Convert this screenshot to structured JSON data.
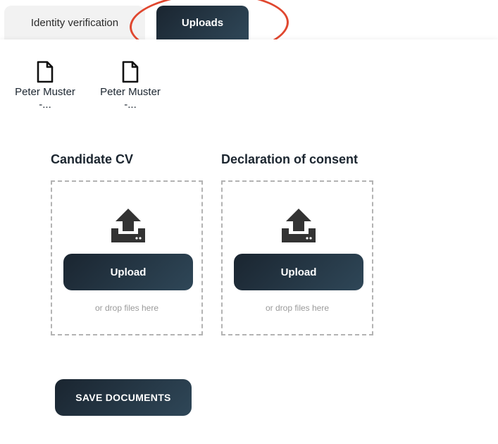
{
  "tabs": [
    {
      "label": "Identity verification",
      "active": false
    },
    {
      "label": "Uploads",
      "active": true
    }
  ],
  "files": [
    {
      "name": "Peter Muster",
      "ellipsis": "-...",
      "icon": "document-icon"
    },
    {
      "name": "Peter Muster",
      "ellipsis": "-...",
      "icon": "document-icon"
    }
  ],
  "uploads": [
    {
      "title": "Candidate CV",
      "button_label": "Upload",
      "hint": "or drop files here",
      "icon": "upload-icon"
    },
    {
      "title": "Declaration of consent",
      "button_label": "Upload",
      "hint": "or drop files here",
      "icon": "upload-icon"
    }
  ],
  "save_label": "SAVE DOCUMENTS",
  "colors": {
    "accent_dark": "#1a2530",
    "accent_light": "#2f4758",
    "highlight": "#e0472f",
    "hint": "#9a9a9a",
    "dash": "#b3b3b3"
  }
}
